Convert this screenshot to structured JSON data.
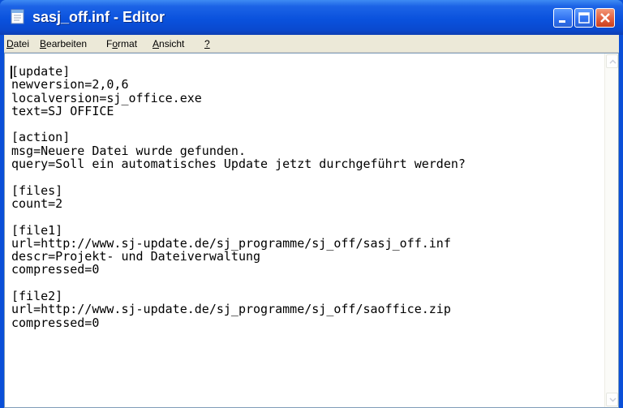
{
  "window": {
    "title": "sasj_off.inf - Editor"
  },
  "menu": {
    "items": [
      {
        "label": "Datei",
        "accel_index": 0
      },
      {
        "label": "Bearbeiten",
        "accel_index": 0
      },
      {
        "label": "Format",
        "accel_index": 1
      },
      {
        "label": "Ansicht",
        "accel_index": 0
      },
      {
        "label": "?",
        "accel_index": 0
      }
    ]
  },
  "editor": {
    "lines": [
      "[update]",
      "newversion=2,0,6",
      "localversion=sj_office.exe",
      "text=SJ OFFICE",
      "",
      "[action]",
      "msg=Neuere Datei wurde gefunden.",
      "query=Soll ein automatisches Update jetzt durchgeführt werden?",
      "",
      "[files]",
      "count=2",
      "",
      "[file1]",
      "url=http://www.sj-update.de/sj_programme/sj_off/sasj_off.inf",
      "descr=Projekt- und Dateiverwaltung",
      "compressed=0",
      "",
      "[file2]",
      "url=http://www.sj-update.de/sj_programme/sj_off/saoffice.zip",
      "compressed=0"
    ]
  },
  "icons": {
    "app": "notepad-icon",
    "minimize": "minimize-icon",
    "maximize": "maximize-icon",
    "close": "close-icon",
    "scroll_up": "chevron-up-icon",
    "scroll_down": "chevron-down-icon"
  },
  "colors": {
    "titlebar": "#0a52dd",
    "close_button": "#e3603f",
    "menubar": "#ece9d8",
    "editor_background": "#ffffff"
  }
}
